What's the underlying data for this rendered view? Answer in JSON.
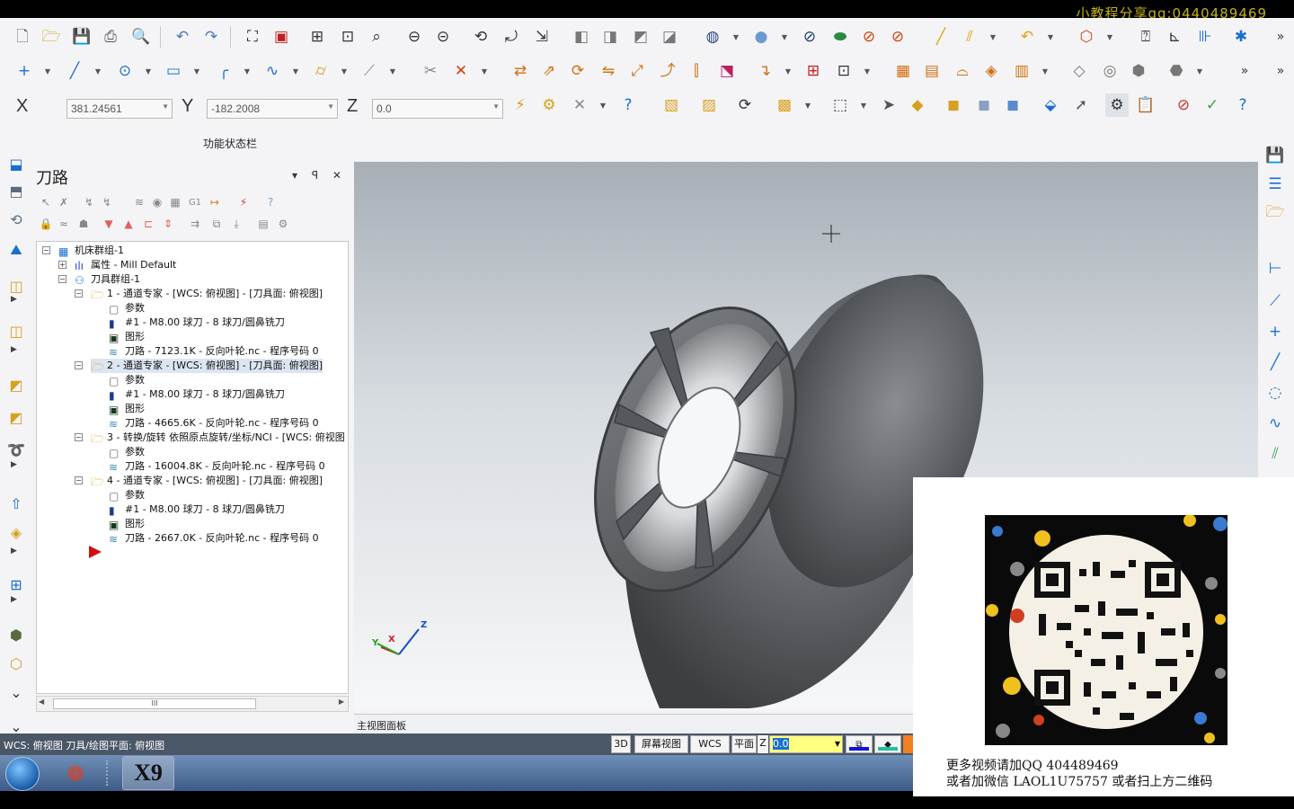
{
  "watermark": "小教程分享qq:0440489469",
  "coords": {
    "x_label": "X",
    "x_value": "381.24561",
    "y_label": "Y",
    "y_value": "-182.2008",
    "z_label": "Z",
    "z_value": "0.0"
  },
  "function_bar": "功能状态栏",
  "panel": {
    "title": "刀路",
    "controls": "▾ ꟼ ✕"
  },
  "tree": [
    {
      "text": "机床群组-1",
      "indent": 0,
      "icon": "machine-group",
      "exp": "−"
    },
    {
      "text": "属性 - Mill Default",
      "indent": 1,
      "icon": "properties",
      "exp": "+"
    },
    {
      "text": "刀具群组-1",
      "indent": 1,
      "icon": "toolgroup",
      "exp": "−"
    },
    {
      "text": "1 - 通道专家 - [WCS: 俯视图] - [刀具面: 俯视图]",
      "indent": 2,
      "icon": "folder",
      "exp": "−"
    },
    {
      "text": "参数",
      "indent": 3,
      "icon": "params"
    },
    {
      "text": "#1 - M8.00 球刀 - 8 球刀/圆鼻铣刀",
      "indent": 3,
      "icon": "tool"
    },
    {
      "text": "图形",
      "indent": 3,
      "icon": "geometry"
    },
    {
      "text": "刀路 - 7123.1K - 反向叶轮.nc - 程序号码 0",
      "indent": 3,
      "icon": "toolpath"
    },
    {
      "text": "2 - 通道专家 - [WCS: 俯视图] - [刀具面: 俯视图]",
      "indent": 2,
      "icon": "folder",
      "exp": "−",
      "selected": true
    },
    {
      "text": "参数",
      "indent": 3,
      "icon": "params"
    },
    {
      "text": "#1 - M8.00 球刀 - 8 球刀/圆鼻铣刀",
      "indent": 3,
      "icon": "tool"
    },
    {
      "text": "图形",
      "indent": 3,
      "icon": "geometry"
    },
    {
      "text": "刀路 - 4665.6K - 反向叶轮.nc - 程序号码 0",
      "indent": 3,
      "icon": "toolpath"
    },
    {
      "text": "3 - 转换/旋转 依照原点旋转/坐标/NCI - [WCS: 俯视图",
      "indent": 2,
      "icon": "folder",
      "exp": "−"
    },
    {
      "text": "参数",
      "indent": 3,
      "icon": "params"
    },
    {
      "text": "刀路 - 16004.8K - 反向叶轮.nc - 程序号码 0",
      "indent": 3,
      "icon": "toolpath"
    },
    {
      "text": "4 - 通道专家 - [WCS: 俯视图] - [刀具面: 俯视图]",
      "indent": 2,
      "icon": "folder",
      "exp": "−"
    },
    {
      "text": "参数",
      "indent": 3,
      "icon": "params"
    },
    {
      "text": "#1 - M8.00 球刀 - 8 球刀/圆鼻铣刀",
      "indent": 3,
      "icon": "tool"
    },
    {
      "text": "图形",
      "indent": 3,
      "icon": "geometry"
    },
    {
      "text": "刀路 - 2667.0K - 反向叶轮.nc - 程序号码 0",
      "indent": 3,
      "icon": "toolpath"
    }
  ],
  "scroll_thumb": "III",
  "view_tab": "主视图面板",
  "axis": {
    "x": "X",
    "y": "Y",
    "z": "Z"
  },
  "status": {
    "text": "WCS: 俯视图  刀具/绘图平面: 俯视图",
    "btn_3d": "3D",
    "btn_screen": "屏幕视图",
    "btn_wcs": "WCS",
    "btn_plane": "平面",
    "z_label": "Z",
    "z_value": "0.0"
  },
  "overlay": {
    "line1": "更多视频请加QQ 404489469",
    "line2": "或者加微信 LAOL1U75757 或者扫上方二维码"
  },
  "taskbar": {
    "app_label": "X9"
  },
  "colors": {
    "app_bg": "#f4f4f6",
    "status_bar": "#4a5766",
    "accent_blue": "#1a6fd0",
    "toolpath_red": "#d01010"
  }
}
